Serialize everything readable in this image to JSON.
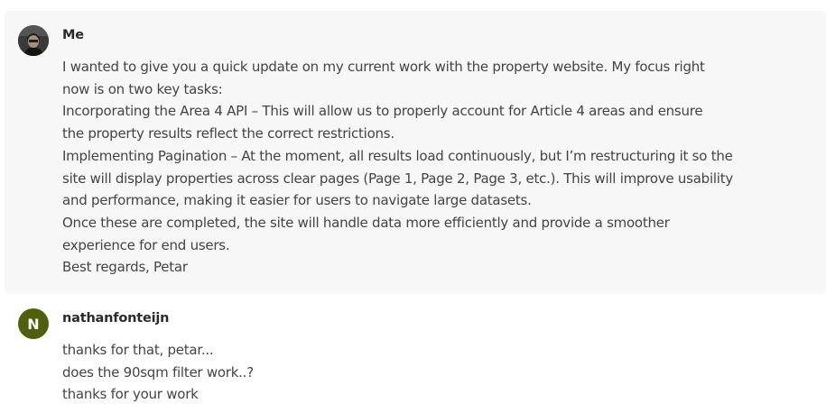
{
  "messages": [
    {
      "author": "Me",
      "avatar": {
        "type": "photo",
        "icon": "user-photo-icon"
      },
      "lines": [
        "I wanted to give you a quick update on my current work with the property website. My focus right",
        "now is on two key tasks:",
        "Incorporating the Area 4 API – This will allow us to properly account for Article 4 areas and ensure",
        "the property results reflect the correct restrictions.",
        "Implementing Pagination – At the moment, all results load continuously, but I’m restructuring it so the",
        "site will display properties across clear pages (Page 1, Page 2, Page 3, etc.). This will improve usability",
        "and performance, making it easier for users to navigate large datasets.",
        "Once these are completed, the site will handle data more efficiently and provide a smoother",
        "experience for end users.",
        "Best regards, Petar"
      ]
    },
    {
      "author": "nathanfonteijn",
      "avatar": {
        "type": "initial",
        "initial": "N",
        "color": "#4f5f0e"
      },
      "lines": [
        "thanks for that, petar...",
        "does the 90sqm filter work..?",
        "thanks for your work"
      ]
    }
  ]
}
